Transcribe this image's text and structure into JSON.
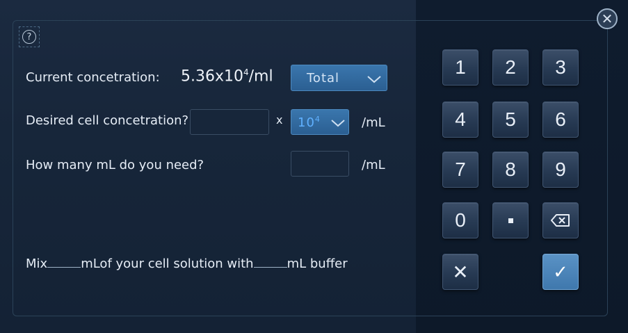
{
  "close": {
    "glyph": "✕"
  },
  "help": {
    "glyph": "?"
  },
  "form": {
    "current_label": "Current concetration:",
    "current_value_base": "5.36x10",
    "current_value_exp": "4",
    "current_value_unit": "/ml",
    "type_dropdown": {
      "selected": "Total"
    },
    "desired_label": "Desired cell concetration?",
    "desired_input": {
      "value": ""
    },
    "times_symbol": "x",
    "exponent_dropdown": {
      "base": "10",
      "exp": "4"
    },
    "desired_unit": "/mL",
    "volume_label": "How many mL do you need?",
    "volume_input": {
      "value": ""
    },
    "volume_unit": "/mL"
  },
  "mix": {
    "prefix": "Mix",
    "middle": "mLof your cell solution with",
    "suffix": "mL buffer"
  },
  "keypad": {
    "keys": [
      "1",
      "2",
      "3",
      "4",
      "5",
      "6",
      "7",
      "8",
      "9",
      "0"
    ],
    "clear_glyph": "✕",
    "confirm_glyph": "✓"
  },
  "colors": {
    "accent": "#3a76ad",
    "background": "#17263a",
    "keypad_background": "#0f1c2e"
  }
}
